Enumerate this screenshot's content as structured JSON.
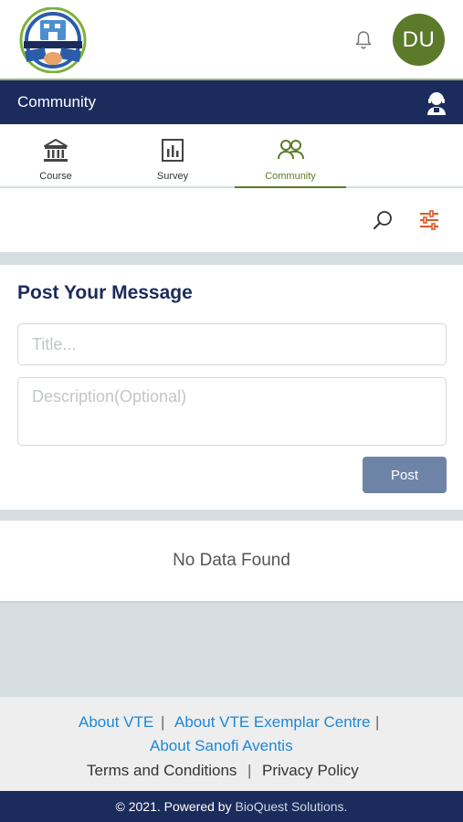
{
  "header": {
    "avatar_initials": "DU",
    "logo_name": "vte-safety-zone-logo",
    "bell_icon": "bell-icon"
  },
  "titlebar": {
    "title": "Community",
    "support_icon": "support-agent-icon"
  },
  "tabs": [
    {
      "label": "Course",
      "icon": "bank-icon",
      "active": false
    },
    {
      "label": "Survey",
      "icon": "bar-chart-icon",
      "active": false
    },
    {
      "label": "Community",
      "icon": "people-icon",
      "active": true
    }
  ],
  "toolbar": {
    "search_icon": "search-icon",
    "filter_icon": "sliders-icon"
  },
  "post_form": {
    "heading": "Post Your Message",
    "title_placeholder": "Title...",
    "title_value": "",
    "description_placeholder": "Description(Optional)",
    "description_value": "",
    "post_label": "Post"
  },
  "feed": {
    "empty_text": "No Data Found"
  },
  "footer": {
    "about_vte": "About VTE",
    "about_exemplar": "About VTE Exemplar Centre",
    "about_sanofi": "About Sanofi Aventis",
    "terms": "Terms and Conditions",
    "privacy": "Privacy Policy",
    "separator": "|",
    "copyright_prefix": "© 2021. Powered by",
    "company": "BioQuest Solutions."
  },
  "colors": {
    "navy": "#1b2b5c",
    "green": "#5b7a2a",
    "link": "#1e88d6",
    "button": "#6d84a6",
    "filter_accent": "#e0592a"
  }
}
